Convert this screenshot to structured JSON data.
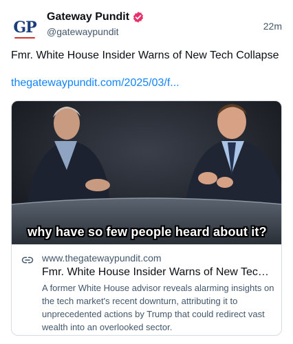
{
  "author": {
    "display_name": "Gateway Pundit",
    "handle": "@gatewaypundit",
    "avatar_text": "GP",
    "verified": true,
    "verified_color": "#e8306a"
  },
  "post": {
    "timestamp": "22m",
    "text": "Fmr. White House Insider Warns of New Tech Collapse",
    "link_text": "thegatewaypundit.com/2025/03/f...",
    "link_color": "#1083fe"
  },
  "embed": {
    "image_caption": "why have so few people heard about it?",
    "domain": "www.thegatewaypundit.com",
    "title": "Fmr. White House Insider Warns of New Tech ...",
    "description": "A former White House advisor reveals alarming insights on the tech market's recent downturn, attributing it to unprecedented actions by Trump that could redirect vast wealth into an overlooked sector.",
    "icon": "link-icon"
  }
}
